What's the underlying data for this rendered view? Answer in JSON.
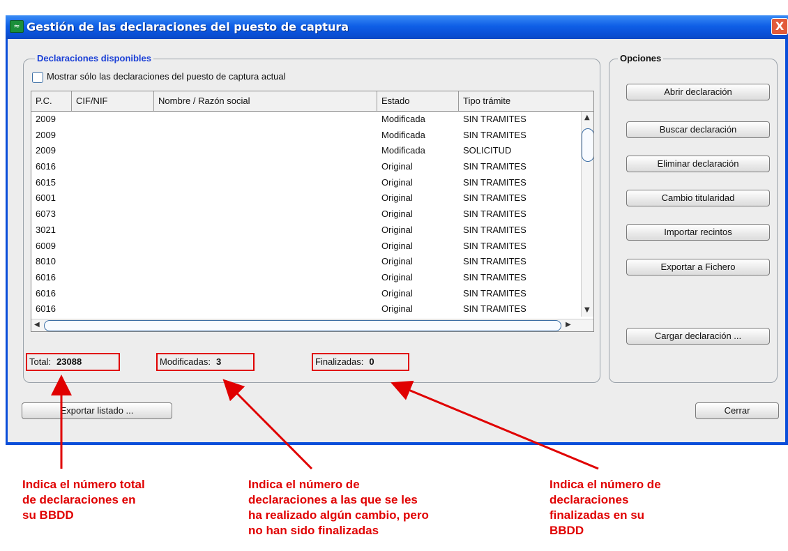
{
  "window": {
    "title": "Gestión de las declaraciones del puesto de captura",
    "close_label": "X"
  },
  "declaraciones": {
    "group_title": "Declaraciones disponibles",
    "checkbox_label": "Mostrar sólo las declaraciones del puesto de captura actual",
    "checkbox_checked": false,
    "columns": [
      "P.C.",
      "CIF/NIF",
      "Nombre / Razón social",
      "Estado",
      "Tipo trámite"
    ],
    "rows": [
      {
        "pc": "2009",
        "cif": "",
        "nombre": "",
        "estado": "Modificada",
        "tipo": "SIN TRAMITES"
      },
      {
        "pc": "2009",
        "cif": "",
        "nombre": "",
        "estado": "Modificada",
        "tipo": "SIN TRAMITES"
      },
      {
        "pc": "2009",
        "cif": "",
        "nombre": "",
        "estado": "Modificada",
        "tipo": "SOLICITUD"
      },
      {
        "pc": "6016",
        "cif": "",
        "nombre": "",
        "estado": "Original",
        "tipo": "SIN TRAMITES"
      },
      {
        "pc": "6015",
        "cif": "",
        "nombre": "",
        "estado": "Original",
        "tipo": "SIN TRAMITES"
      },
      {
        "pc": "6001",
        "cif": "",
        "nombre": "",
        "estado": "Original",
        "tipo": "SIN TRAMITES"
      },
      {
        "pc": "6073",
        "cif": "",
        "nombre": "",
        "estado": "Original",
        "tipo": "SIN TRAMITES"
      },
      {
        "pc": "3021",
        "cif": "",
        "nombre": "",
        "estado": "Original",
        "tipo": "SIN TRAMITES"
      },
      {
        "pc": "6009",
        "cif": "",
        "nombre": "",
        "estado": "Original",
        "tipo": "SIN TRAMITES"
      },
      {
        "pc": "8010",
        "cif": "",
        "nombre": "",
        "estado": "Original",
        "tipo": "SIN TRAMITES"
      },
      {
        "pc": "6016",
        "cif": "",
        "nombre": "",
        "estado": "Original",
        "tipo": "SIN TRAMITES"
      },
      {
        "pc": "6016",
        "cif": "",
        "nombre": "",
        "estado": "Original",
        "tipo": "SIN TRAMITES"
      },
      {
        "pc": "6016",
        "cif": "",
        "nombre": "",
        "estado": "Original",
        "tipo": "SIN TRAMITES"
      }
    ],
    "total_label": "Total:",
    "total_value": "23088",
    "modificadas_label": "Modificadas:",
    "modificadas_value": "3",
    "finalizadas_label": "Finalizadas:",
    "finalizadas_value": "0"
  },
  "opciones": {
    "group_title": "Opciones",
    "buttons": [
      "Abrir declaración",
      "Buscar declaración",
      "Eliminar declaración",
      "Cambio titularidad",
      "Importar recintos",
      "Exportar a Fichero",
      "Cargar declaración ..."
    ]
  },
  "bottom": {
    "exportar_label": "Exportar listado ...",
    "cerrar_label": "Cerrar"
  },
  "annotations": {
    "total": [
      "Indica el número total",
      "de declaraciones en",
      "su BBDD"
    ],
    "modificadas": [
      "Indica el número de",
      "declaraciones a las que se les",
      "ha realizado algún cambio, pero",
      "no han sido finalizadas"
    ],
    "finalizadas": [
      "Indica el número de",
      "declaraciones",
      "finalizadas en su",
      "BBDD"
    ]
  },
  "colors": {
    "annotation": "#e00000",
    "titlebar": "#0a4ed9",
    "group_title_link": "#1a3fd6"
  }
}
